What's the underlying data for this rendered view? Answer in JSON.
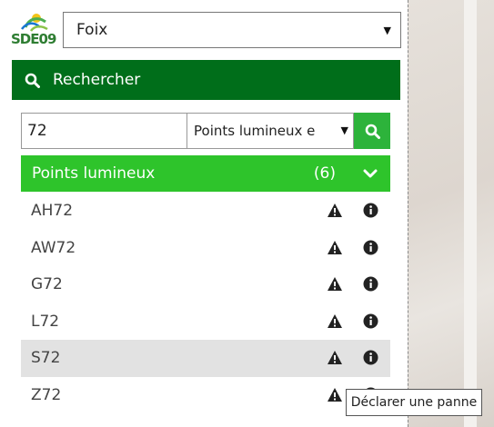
{
  "logo": {
    "text": "SDE09"
  },
  "commune_select": {
    "value": "Foix"
  },
  "search_header": {
    "label": "Rechercher"
  },
  "search": {
    "query": "72",
    "type_value": "Points lumineux e"
  },
  "results_header": {
    "label": "Points lumineux",
    "count": "(6)"
  },
  "results": [
    {
      "label": "AH72"
    },
    {
      "label": "AW72"
    },
    {
      "label": "G72"
    },
    {
      "label": "L72"
    },
    {
      "label": "S72"
    },
    {
      "label": "Z72"
    }
  ],
  "tooltip": {
    "text": "Déclarer une panne"
  },
  "colors": {
    "header_dark_green": "#006e1a",
    "results_green": "#2ec42b",
    "button_green": "#2db33b",
    "hover_row": "#e2e2e2"
  },
  "icons": {
    "search": "search-icon",
    "warning": "warning-icon",
    "info": "info-icon",
    "chevron": "chevron-down-icon",
    "caret": "caret-down-icon"
  }
}
